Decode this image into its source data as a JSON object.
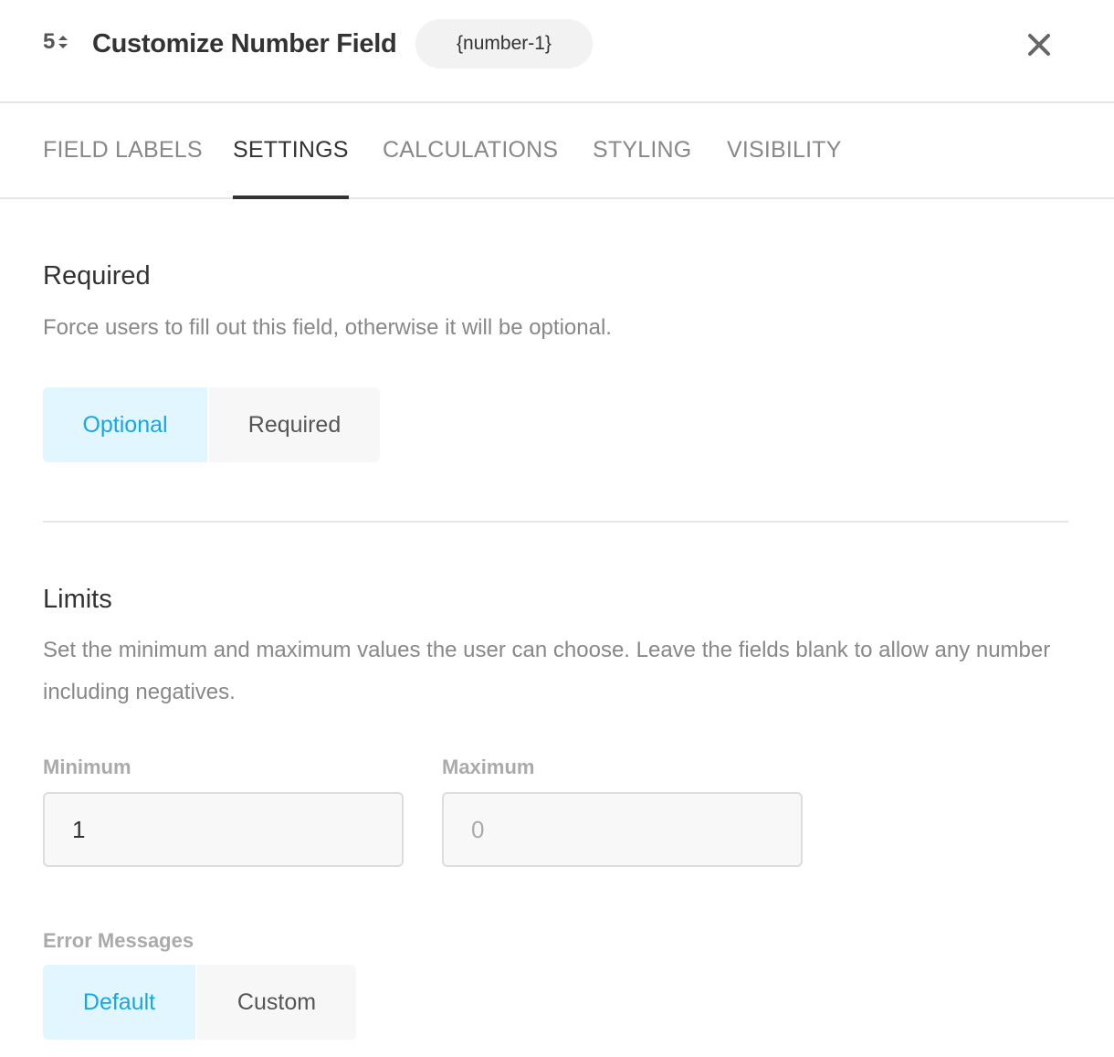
{
  "header": {
    "field_icon_digit": "5",
    "title": "Customize Number Field",
    "tag": "{number-1}",
    "close_icon": "close-icon"
  },
  "tabs": [
    {
      "label": "FIELD LABELS",
      "active": false
    },
    {
      "label": "SETTINGS",
      "active": true
    },
    {
      "label": "CALCULATIONS",
      "active": false
    },
    {
      "label": "STYLING",
      "active": false
    },
    {
      "label": "VISIBILITY",
      "active": false
    }
  ],
  "required_section": {
    "title": "Required",
    "description": "Force users to fill out this field, otherwise it will be optional.",
    "options": [
      {
        "label": "Optional",
        "selected": true
      },
      {
        "label": "Required",
        "selected": false
      }
    ]
  },
  "limits_section": {
    "title": "Limits",
    "description": "Set the minimum and maximum values the user can choose. Leave the fields blank to allow any number including negatives.",
    "minimum": {
      "label": "Minimum",
      "value": "1",
      "placeholder": ""
    },
    "maximum": {
      "label": "Maximum",
      "value": "",
      "placeholder": "0"
    },
    "error_messages": {
      "label": "Error Messages",
      "options": [
        {
          "label": "Default",
          "selected": true
        },
        {
          "label": "Custom",
          "selected": false
        }
      ]
    }
  },
  "colors": {
    "accent": "#17a8e3",
    "accent_bg": "#e1f6ff",
    "text_primary": "#333333",
    "text_muted": "#888888"
  }
}
